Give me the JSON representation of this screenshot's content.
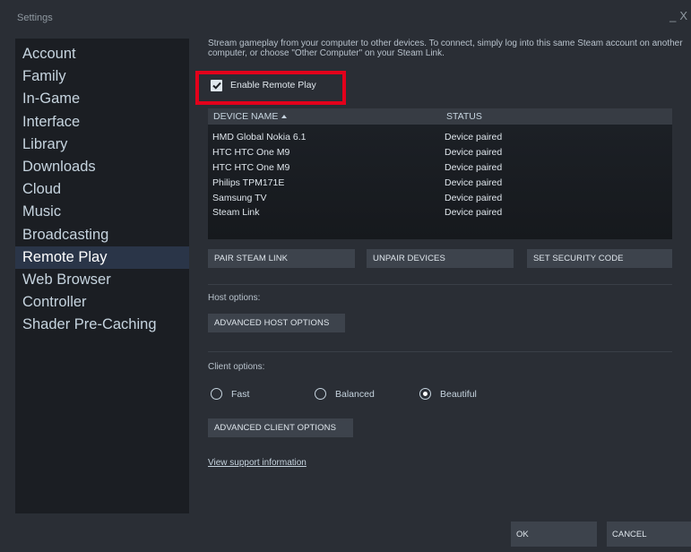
{
  "window": {
    "title": "Settings",
    "minimize": "_",
    "close": "X"
  },
  "sidebar": {
    "items": [
      {
        "label": "Account"
      },
      {
        "label": "Family"
      },
      {
        "label": "In-Game"
      },
      {
        "label": "Interface"
      },
      {
        "label": "Library"
      },
      {
        "label": "Downloads"
      },
      {
        "label": "Cloud"
      },
      {
        "label": "Music"
      },
      {
        "label": "Broadcasting"
      },
      {
        "label": "Remote Play",
        "active": true
      },
      {
        "label": "Web Browser"
      },
      {
        "label": "Controller"
      },
      {
        "label": "Shader Pre-Caching"
      }
    ]
  },
  "remote_play": {
    "description": "Stream gameplay from your computer to other devices. To connect, simply log into this same Steam account on another computer, or choose \"Other Computer\" on your Steam Link.",
    "enable_label": "Enable Remote Play",
    "enable_checked": true,
    "table": {
      "columns": [
        "DEVICE NAME",
        "STATUS"
      ],
      "rows": [
        {
          "name": "HMD Global Nokia 6.1",
          "status": "Device paired"
        },
        {
          "name": "HTC HTC One M9",
          "status": "Device paired"
        },
        {
          "name": "HTC HTC One M9",
          "status": "Device paired"
        },
        {
          "name": "Philips TPM171E",
          "status": "Device paired"
        },
        {
          "name": "Samsung TV",
          "status": "Device paired"
        },
        {
          "name": "Steam Link",
          "status": "Device paired"
        }
      ]
    },
    "buttons": {
      "pair_steam_link": "PAIR STEAM LINK",
      "unpair_devices": "UNPAIR DEVICES",
      "set_security_code": "SET SECURITY CODE",
      "advanced_host": "ADVANCED HOST OPTIONS",
      "advanced_client": "ADVANCED CLIENT OPTIONS"
    },
    "host_options_label": "Host options:",
    "client_options_label": "Client options:",
    "client_options": {
      "fast": "Fast",
      "balanced": "Balanced",
      "beautiful": "Beautiful",
      "selected": "Beautiful"
    },
    "support_link": "View support information"
  },
  "footer": {
    "ok": "OK",
    "cancel": "CANCEL"
  },
  "colors": {
    "highlight_border": "#e3001b",
    "active_sidebar": "#2a3548"
  }
}
